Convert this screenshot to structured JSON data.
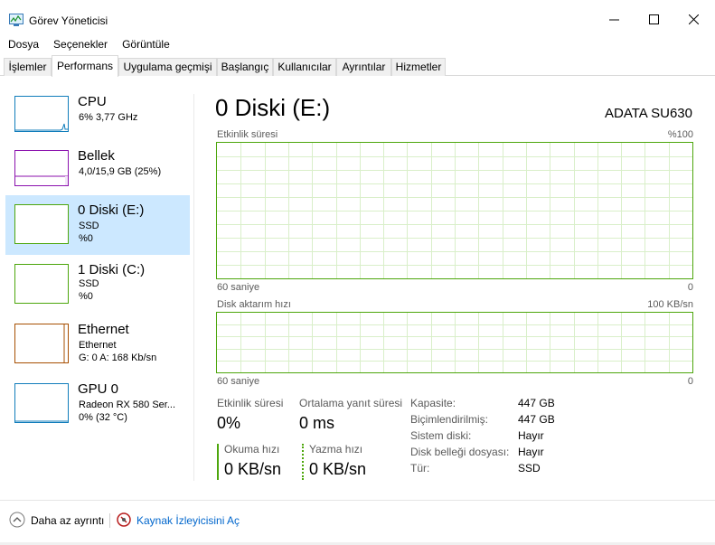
{
  "window": {
    "title": "Görev Yöneticisi"
  },
  "menu": [
    "Dosya",
    "Seçenekler",
    "Görüntüle"
  ],
  "tabs": [
    {
      "label": "İşlemler",
      "active": false
    },
    {
      "label": "Performans",
      "active": true
    },
    {
      "label": "Uygulama geçmişi",
      "active": false
    },
    {
      "label": "Başlangıç",
      "active": false
    },
    {
      "label": "Kullanıcılar",
      "active": false
    },
    {
      "label": "Ayrıntılar",
      "active": false
    },
    {
      "label": "Hizmetler",
      "active": false
    }
  ],
  "resources": [
    {
      "name": "CPU",
      "sub1": "6%  3,77 GHz",
      "sub2": "",
      "sub3": "",
      "color": "#117dbb",
      "selected": false
    },
    {
      "name": "Bellek",
      "sub1": "4,0/15,9 GB (25%)",
      "sub2": "",
      "sub3": "",
      "color": "#8b12ae",
      "selected": false
    },
    {
      "name": "0 Diski (E:)",
      "sub1": "SSD",
      "sub2": "%0",
      "sub3": "",
      "color": "#4da60c",
      "selected": true
    },
    {
      "name": "1 Diski (C:)",
      "sub1": "SSD",
      "sub2": "%0",
      "sub3": "",
      "color": "#4da60c",
      "selected": false
    },
    {
      "name": "Ethernet",
      "sub1": "Ethernet",
      "sub2": "G: 0  A: 168 Kb/sn",
      "sub3": "",
      "color": "#a74f01",
      "selected": false
    },
    {
      "name": "GPU 0",
      "sub1": "Radeon RX 580 Ser...",
      "sub2": "0%  (32 °C)",
      "sub3": "",
      "color": "#117dbb",
      "selected": false
    }
  ],
  "main": {
    "title": "0 Diski (E:)",
    "model": "ADATA SU630",
    "graph1": {
      "label": "Etkinlik süresi",
      "max": "%100",
      "xleft": "60 saniye",
      "xright": "0"
    },
    "graph2": {
      "label": "Disk aktarım hızı",
      "max": "100 KB/sn",
      "xleft": "60 saniye",
      "xright": "0"
    },
    "stats": {
      "active_label": "Etkinlik süresi",
      "active_value": "0%",
      "response_label": "Ortalama yanıt süresi",
      "response_value": "0 ms",
      "read_label": "Okuma hızı",
      "read_value": "0 KB/sn",
      "write_label": "Yazma hızı",
      "write_value": "0 KB/sn"
    },
    "properties": [
      {
        "label": "Kapasite:",
        "value": "447 GB"
      },
      {
        "label": "Biçimlendirilmiş:",
        "value": "447 GB"
      },
      {
        "label": "Sistem diski:",
        "value": "Hayır"
      },
      {
        "label": "Disk belleği dosyası:",
        "value": "Hayır"
      },
      {
        "label": "Tür:",
        "value": "SSD"
      }
    ]
  },
  "footer": {
    "fewer_details": "Daha az ayrıntı",
    "resource_monitor": "Kaynak İzleyicisini Aç"
  },
  "colors": {
    "disk": "#4da60c",
    "cpu": "#117dbb",
    "memory": "#8b12ae",
    "ethernet": "#a74f01",
    "selected_bg": "#cce8ff",
    "link": "#0066cc"
  }
}
